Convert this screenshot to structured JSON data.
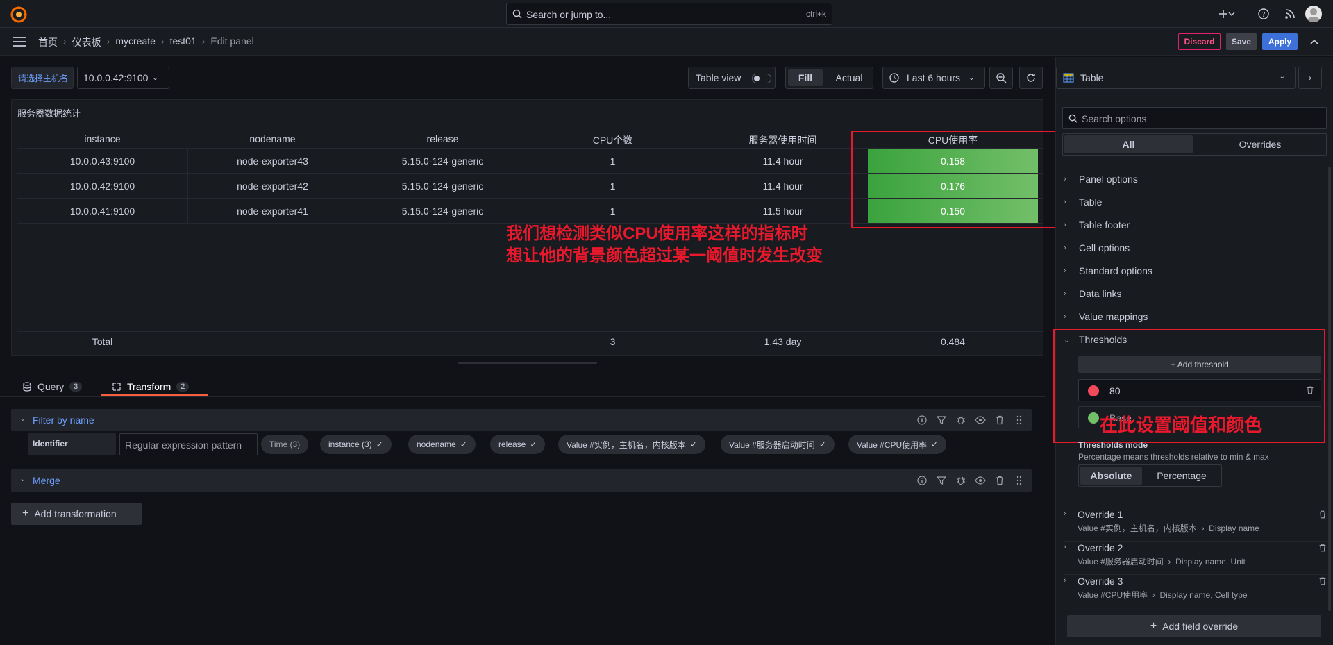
{
  "topbar": {
    "search_placeholder": "Search or jump to...",
    "search_shortcut": "ctrl+k"
  },
  "breadcrumb": {
    "items": [
      "首页",
      "仪表板",
      "mycreate",
      "test01"
    ],
    "current": "Edit panel"
  },
  "actions": {
    "discard": "Discard",
    "save": "Save",
    "apply": "Apply"
  },
  "toolbar": {
    "variable_label": "请选择主机名",
    "variable_value": "10.0.0.42:9100",
    "table_view": "Table view",
    "fill": "Fill",
    "actual": "Actual",
    "time_range": "Last 6 hours"
  },
  "panel": {
    "title": "服务器数据统计",
    "columns": [
      "instance",
      "nodename",
      "release",
      "CPU个数",
      "服务器使用时间",
      "CPU使用率"
    ],
    "rows": [
      [
        "10.0.0.43:9100",
        "node-exporter43",
        "5.15.0-124-generic",
        "1",
        "11.4 hour",
        "0.158"
      ],
      [
        "10.0.0.42:9100",
        "node-exporter42",
        "5.15.0-124-generic",
        "1",
        "11.4 hour",
        "0.176"
      ],
      [
        "10.0.0.41:9100",
        "node-exporter41",
        "5.15.0-124-generic",
        "1",
        "11.5 hour",
        "0.150"
      ]
    ],
    "footer": {
      "label": "Total",
      "cpu_count": "3",
      "uptime": "1.43 day",
      "cpu_usage": "0.484"
    },
    "cell_color": "#56b04d"
  },
  "annotations": {
    "main_line1": "我们想检测类似CPU使用率这样的指标时",
    "main_line2": "想让他的背景颜色超过某一阈值时发生改变",
    "thresholds_note": "在此设置阈值和颜色",
    "color": "#e8192c"
  },
  "tabs": [
    {
      "label": "Query",
      "count": "3"
    },
    {
      "label": "Transform",
      "count": "2"
    }
  ],
  "transforms": {
    "filter": {
      "title": "Filter by name",
      "identifier_label": "Identifier",
      "identifier_placeholder": "Regular expression pattern",
      "chips": [
        {
          "label": "Time (3)",
          "selected": false
        },
        {
          "label": "instance (3)",
          "selected": true
        },
        {
          "label": "nodename",
          "selected": true
        },
        {
          "label": "release",
          "selected": true
        },
        {
          "label": "Value #实例，主机名，内核版本",
          "selected": true
        },
        {
          "label": "Value #服务器启动时间",
          "selected": true
        },
        {
          "label": "Value #CPU使用率",
          "selected": true
        }
      ]
    },
    "merge": {
      "title": "Merge"
    },
    "add_button": "Add transformation"
  },
  "options": {
    "visualization": "Table",
    "search_placeholder": "Search options",
    "tabs": [
      "All",
      "Overrides"
    ],
    "groups": [
      "Panel options",
      "Table",
      "Table footer",
      "Cell options",
      "Standard options",
      "Data links",
      "Value mappings"
    ],
    "thresholds": {
      "title": "Thresholds",
      "add_button": "+ Add threshold",
      "steps": [
        {
          "value": "80",
          "color": "#f2495c"
        },
        {
          "value": "Base",
          "color": "#73bf69"
        }
      ],
      "mode_title": "Thresholds mode",
      "mode_desc": "Percentage means thresholds relative to min & max",
      "modes": [
        "Absolute",
        "Percentage"
      ],
      "selected_mode": "Absolute"
    },
    "overrides": [
      {
        "title": "Override 1",
        "matcher": "Value #实例，主机名，内核版本",
        "props": "Display name"
      },
      {
        "title": "Override 2",
        "matcher": "Value #服务器启动时间",
        "props": "Display name, Unit"
      },
      {
        "title": "Override 3",
        "matcher": "Value #CPU使用率",
        "props": "Display name, Cell type"
      }
    ],
    "add_override": "Add field override"
  }
}
